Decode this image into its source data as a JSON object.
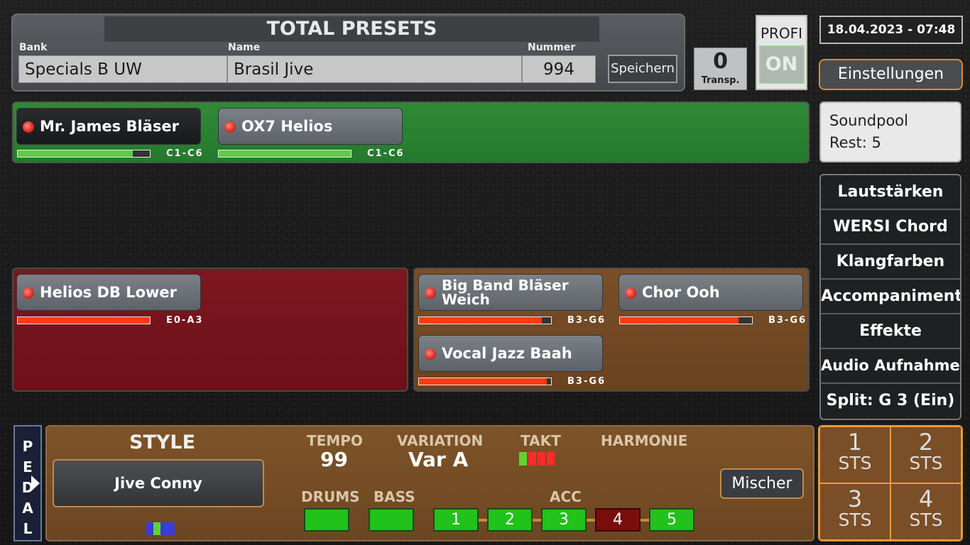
{
  "preset": {
    "title": "TOTAL PRESETS",
    "bank_label": "Bank",
    "bank_value": "Specials B UW",
    "name_label": "Name",
    "name_value": "Brasil Jive",
    "number_label": "Nummer",
    "number_value": "994",
    "save_label": "Speichern"
  },
  "transpose": {
    "value": "0",
    "label": "Transp."
  },
  "profi": {
    "label": "PROFI",
    "state": "ON"
  },
  "datetime": "18.04.2023 - 07:48",
  "settings_label": "Einstellungen",
  "soundpool": {
    "line1": "Soundpool",
    "line2": "Rest: 5"
  },
  "upper_voices": [
    {
      "name": "Mr. James Bläser",
      "range": "C1-C6",
      "level": 0.87
    },
    {
      "name": "OX7 Helios",
      "range": "C1-C6",
      "level": 1.0
    }
  ],
  "lower_voices": [
    {
      "name": "Helios DB Lower",
      "range": "E0-A3",
      "level": 1.0
    }
  ],
  "lower2_voices": [
    {
      "name": "Big Band Bläser Weich",
      "range": "B3-G6",
      "level": 0.93
    },
    {
      "name": "Chor Ooh",
      "range": "B3-G6",
      "level": 0.9
    },
    {
      "name": "Vocal Jazz Baah",
      "range": "B3-G6",
      "level": 0.97
    }
  ],
  "menu": [
    "Lautstärken",
    "WERSI Chord",
    "Klangfarben",
    "Accompaniment",
    "Effekte",
    "Audio Aufnahmen",
    "Split: G 3 (Ein)"
  ],
  "pedal_label": [
    "P",
    "E",
    "D",
    "A",
    "L"
  ],
  "style": {
    "title": "STYLE",
    "name": "Jive Conny",
    "tempo_label": "TEMPO",
    "tempo_value": "99",
    "variation_label": "VARIATION",
    "variation_value": "Var A",
    "takt_label": "TAKT",
    "harmonie_label": "HARMONIE",
    "drums_label": "DRUMS",
    "bass_label": "BASS",
    "acc_label": "ACC",
    "acc_pads": [
      "1",
      "2",
      "3",
      "4",
      "5"
    ],
    "mixer_label": "Mischer"
  },
  "sts": [
    {
      "n": "1",
      "t": "STS"
    },
    {
      "n": "2",
      "t": "STS"
    },
    {
      "n": "3",
      "t": "STS"
    },
    {
      "n": "4",
      "t": "STS"
    }
  ],
  "colors": {
    "range_green": "#5ecb3f",
    "range_red": "#ff3a12",
    "accent_orange": "#e89a3a",
    "pad_on": "#21c21a",
    "pad_off": "#7a0c0c"
  }
}
